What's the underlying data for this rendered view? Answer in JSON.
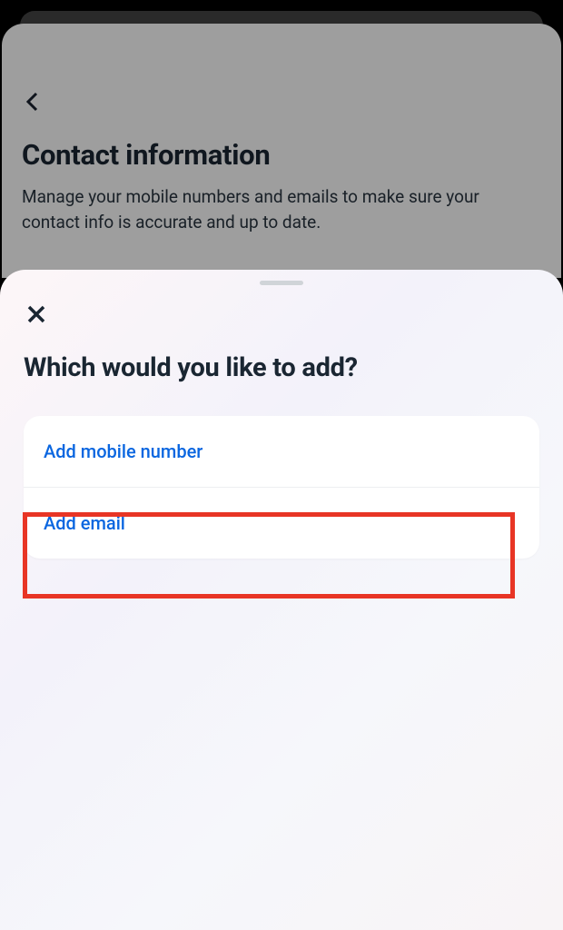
{
  "page": {
    "title": "Contact information",
    "description": "Manage your mobile numbers and emails to make sure your contact info is accurate and up to date."
  },
  "sheet": {
    "title": "Which would you like to add?",
    "options": [
      {
        "label": "Add mobile number"
      },
      {
        "label": "Add email"
      }
    ]
  }
}
